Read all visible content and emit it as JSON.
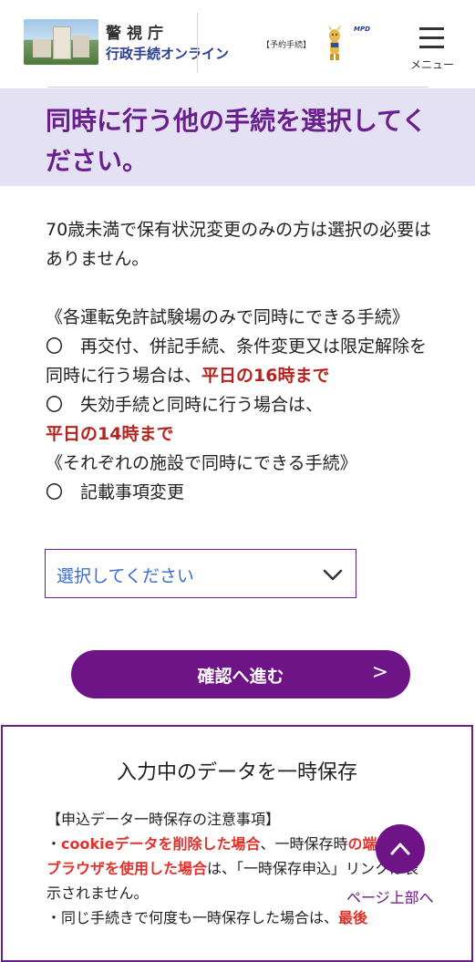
{
  "header": {
    "logo_line1": "警視庁",
    "logo_line2": "行政手続オンライン",
    "badge": "【予約手続】",
    "mpd_logo": "MPD",
    "menu_label": "メニュー"
  },
  "page": {
    "title": "同時に行う他の手続を選択してください。"
  },
  "content": {
    "intro": "70歳未満で保有状況変更のみの方は選択の必要はありません。",
    "section1_heading": "《各運転免許試験場のみで同時にできる手続》",
    "item1_text": "〇　再交付、併記手続、条件変更又は限定解除を同時に行う場合は、",
    "item1_deadline": "平日の16時まで",
    "item2_text": "〇　失効手続と同時に行う場合は、",
    "item2_deadline": "平日の14時まで",
    "section2_heading": "《それぞれの施設で同時にできる手続》",
    "item3_text": "〇　記載事項変更"
  },
  "select": {
    "value": "選択してください"
  },
  "confirm_button": {
    "label": "確認へ進む",
    "arrow": ">"
  },
  "save_panel": {
    "title": "入力中のデータを一時保存",
    "notice_heading": "【申込データ一時保存の注意事項】",
    "bullet1_prefix": "・",
    "bullet1_red1": "cookieデータを削除した場合",
    "bullet1_mid": "、一時保存時",
    "bullet1_red2": "の端末又はブラウザを使用した場合",
    "bullet1_tail": "は、「一時保存申込」リンクは表示されません。",
    "bullet2_text": "・同じ手続きで何度も一時保存した場合は、",
    "bullet2_red": "最後"
  },
  "scroll_top": {
    "label": "ページ上部へ"
  },
  "colors": {
    "brand_purple": "#6e1486",
    "title_band": "#e5e1f5",
    "deadline_red": "#b5231f",
    "link_blue": "#3a6fd1"
  }
}
